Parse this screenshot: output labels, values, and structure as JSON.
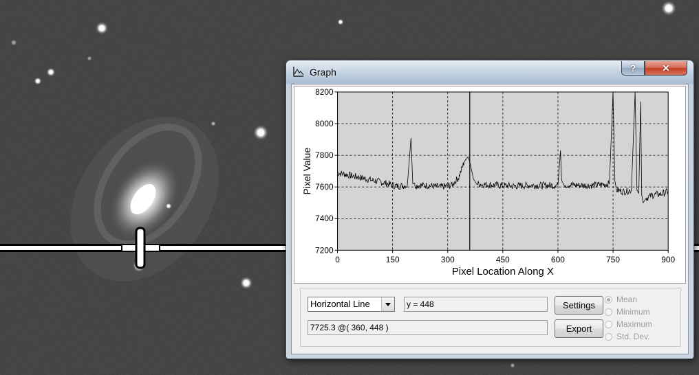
{
  "window": {
    "title": "Graph",
    "help_label": "?",
    "close_label": "✕"
  },
  "controls": {
    "mode_select": "Horizontal Line",
    "position_value": "y = 448",
    "readout": "7725.3 @( 360, 448 )",
    "settings_label": "Settings",
    "export_label": "Export",
    "radios": [
      {
        "label": "Mean",
        "selected": true
      },
      {
        "label": "Minimum",
        "selected": false
      },
      {
        "label": "Maximum",
        "selected": false
      },
      {
        "label": "Std. Dev.",
        "selected": false
      }
    ]
  },
  "chart_data": {
    "type": "line",
    "xlabel": "Pixel Location Along X",
    "ylabel": "Pixel Value",
    "xlim": [
      0,
      900
    ],
    "ylim": [
      7200,
      8200
    ],
    "xticks": [
      0,
      150,
      300,
      450,
      600,
      750,
      900
    ],
    "yticks": [
      7200,
      7400,
      7600,
      7800,
      8000,
      8200
    ],
    "grid": true,
    "background": "#d4d4d4",
    "line_color": "#000000",
    "cursor_x": 360,
    "series": [
      {
        "x": [
          0,
          40,
          80,
          120,
          160,
          190,
          200,
          205,
          210,
          240,
          280,
          310,
          330,
          345,
          355,
          360,
          370,
          380,
          400,
          440,
          480,
          520,
          560,
          600,
          607,
          610,
          620,
          660,
          700,
          740,
          750,
          755,
          760,
          780,
          800,
          810,
          815,
          820,
          825,
          828,
          832,
          840,
          860,
          880,
          900
        ],
        "y": [
          7690,
          7670,
          7650,
          7630,
          7605,
          7610,
          7910,
          7620,
          7610,
          7610,
          7600,
          7610,
          7660,
          7760,
          7790,
          7760,
          7650,
          7620,
          7615,
          7610,
          7605,
          7610,
          7610,
          7610,
          7830,
          7640,
          7615,
          7610,
          7610,
          7620,
          8200,
          7640,
          7580,
          7570,
          7580,
          8200,
          7580,
          7560,
          8140,
          7550,
          7500,
          7530,
          7550,
          7555,
          7570
        ]
      }
    ]
  },
  "overlay": {
    "line_y_pixel_label": "",
    "colors": {
      "line": "#ffffff",
      "outline": "#000000"
    }
  }
}
